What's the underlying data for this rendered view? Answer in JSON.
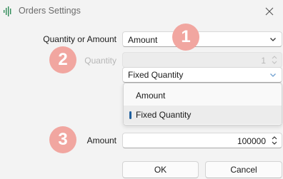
{
  "window": {
    "title": "Orders Settings",
    "app_icon": "waveform-app-icon",
    "close_icon": "close-icon"
  },
  "form": {
    "quantity_or_amount": {
      "label": "Quantity or Amount",
      "value": "Amount"
    },
    "quantity": {
      "label": "Quantity",
      "value": "1",
      "enabled": false
    },
    "quantity_mode": {
      "value": "Fixed Quantity",
      "options": [
        "Amount",
        "Fixed Quantity"
      ],
      "selected_option": "Fixed Quantity"
    },
    "amount": {
      "label": "Amount",
      "value": "100000"
    }
  },
  "annotations": {
    "badge_1": "1",
    "badge_2": "2",
    "badge_3": "3",
    "badge_color": "#f1a6a0"
  },
  "buttons": {
    "ok": "OK",
    "cancel": "Cancel"
  },
  "colors": {
    "selection_marker": "#1f5f9e",
    "background": "#f3f3f3"
  }
}
